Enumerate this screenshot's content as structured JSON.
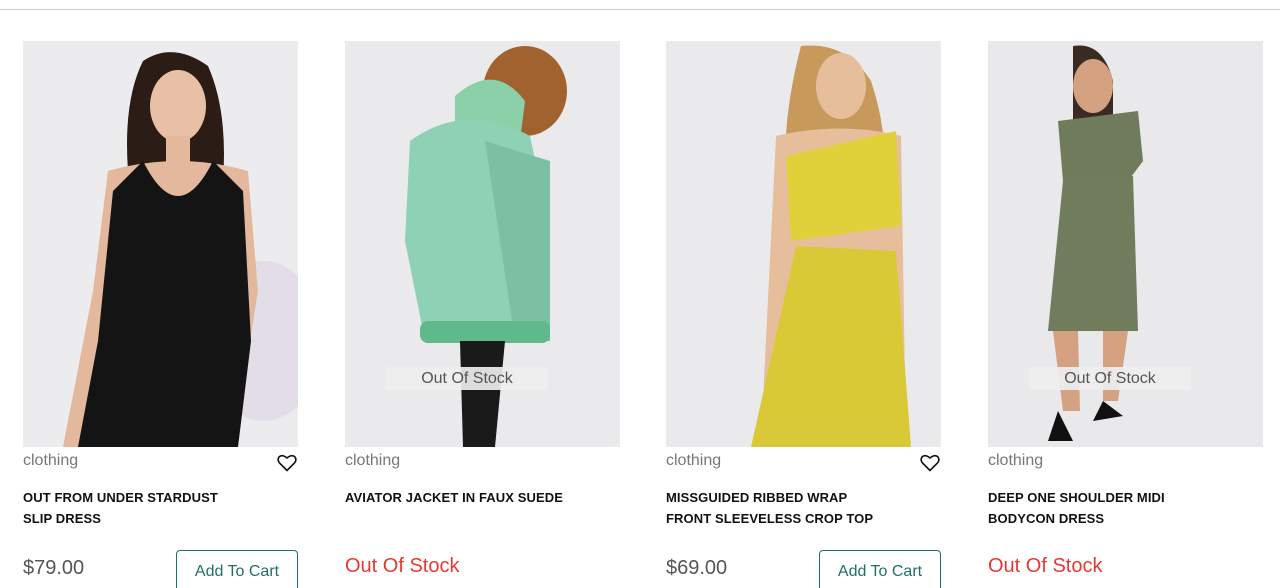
{
  "products": [
    {
      "category": "clothing",
      "title_line1": "OUT FROM UNDER STARDUST",
      "title_line2": "SLIP DRESS",
      "price": "$79.00",
      "cart_label": "Add To Cart",
      "image_desc_icon": "black-slip-dress-photo"
    },
    {
      "category": "clothing",
      "title_line1": "AVIATOR JACKET IN FAUX SUEDE",
      "title_line2": "",
      "overlay": "Out Of Stock",
      "stock_text": "Out Of Stock",
      "image_desc_icon": "mint-aviator-jacket-photo"
    },
    {
      "category": "clothing",
      "title_line1": "MISSGUIDED RIBBED WRAP",
      "title_line2": "FRONT SLEEVELESS CROP TOP",
      "price": "$69.00",
      "cart_label": "Add To Cart",
      "image_desc_icon": "yellow-ribbed-set-photo"
    },
    {
      "category": "clothing",
      "title_line1": "DEEP ONE SHOULDER MIDI",
      "title_line2": "BODYCON DRESS",
      "overlay": "Out Of Stock",
      "stock_text": "Out Of Stock",
      "image_desc_icon": "olive-bodycon-dress-photo"
    }
  ],
  "colors": {
    "accent": "#1f6f6b",
    "out_of_stock": "#e53935",
    "price": "#555555"
  }
}
